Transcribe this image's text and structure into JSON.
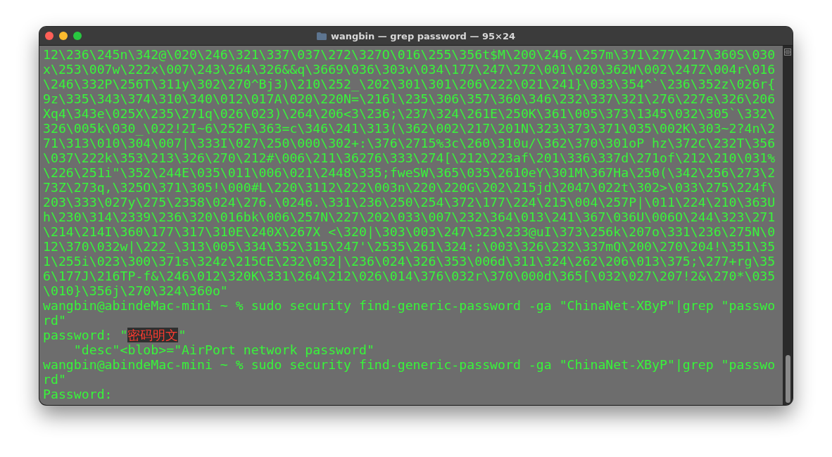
{
  "window": {
    "title": "wangbin — grep password — 95×24"
  },
  "lines": [
    {
      "text": "12\\236\\245n\\342@\\020\\246\\321\\337\\037\\272\\327O\\016\\255\\356t$M\\200\\246,\\257m\\371\\277\\217\\360S\\030"
    },
    {
      "text": "x\\253\\007w\\222x\\007\\243\\264\\326&&q\\3669\\036\\303v\\034\\177\\247\\272\\001\\020\\362W\\002\\247Z\\004r\\016"
    },
    {
      "text": "\\246\\332P\\256T\\311y\\302\\270^Bj3)\\210\\252_\\202\\301\\301\\206\\222\\021\\241}\\033\\354^`\\236\\352z\\026r{"
    },
    {
      "text": "9z\\335\\343\\374\\310\\340\\012\\017A\\020\\220N=\\216l\\235\\306\\357\\360\\346\\232\\337\\321\\276\\227e\\326\\206"
    },
    {
      "text": "Xq4\\343e\\025X\\235\\271q\\026\\023)\\264\\206<3\\236;\\237\\324\\261E\\250K\\361\\005\\373\\1345\\032\\305`\\332\\"
    },
    {
      "text": "326\\005k\\030_\\022!2I~6\\252F\\363=c\\346\\241\\313(\\362\\002\\217\\201N\\323\\373\\371\\035\\002K\\303~2?4n\\2"
    },
    {
      "text": "71\\313\\010\\304\\007|\\333I\\027\\250\\000\\302+:\\376\\2715%3c\\260\\310u/\\362\\370\\301oP hz\\372C\\232T\\356"
    },
    {
      "text": "\\037\\222k\\353\\213\\326\\270\\212#\\006\\211\\36276\\333\\274[\\212\\223af\\201\\336\\337d\\271of\\212\\210\\031%"
    },
    {
      "text": "\\226\\251i\"\\352\\244E\\035\\011\\006\\021\\2448\\335;fweSW\\365\\035\\2610eY\\301M\\367Ha\\250(\\342\\256\\273\\2"
    },
    {
      "text": "73Z\\273q,\\325O\\371\\305!\\000#L\\220\\3112\\222\\003n\\220\\220G\\202\\215jd\\2047\\022t\\302>\\033\\275\\224f\\"
    },
    {
      "text": "203\\333\\027y\\275\\2358\\024\\276.\\0246.\\331\\236\\250\\254\\372\\177\\224\\215\\004\\257P|\\011\\224\\210\\363U"
    },
    {
      "text": "h\\230\\314\\2339\\236\\320\\016bk\\006\\257N\\227\\202\\033\\007\\232\\364\\013\\241\\367\\036U\\006O\\244\\323\\271"
    },
    {
      "text": "\\214\\214I\\360\\177\\317\\310E\\240X\\267X <\\320|\\303\\003\\247\\323\\233@uI\\373\\256k\\207o\\331\\236\\275N\\0"
    },
    {
      "text": "12\\370\\032w|\\222_\\313\\005\\334\\352\\315\\247'\\2535\\261\\324:;\\003\\326\\232\\337mQ\\200\\270\\204!\\351\\35"
    },
    {
      "text": "1\\255i\\023\\300\\371s\\324z\\215CE\\232\\032|\\236\\024\\326\\353\\006d\\311\\324\\262\\206\\013\\375;\\277+rg\\35"
    },
    {
      "text": "6\\177J\\216TP-f&\\246\\012\\320K\\331\\264\\212\\026\\014\\376\\032r\\370\\000d\\365[\\032\\027\\207!2&\\270*\\035"
    },
    {
      "text": "\\010}\\356j\\270\\324\\360o\""
    },
    {
      "text": "wangbin@abindeMac-mini ~ % sudo security find-generic-password -ga \"ChinaNet-XByP\"|grep \"passwo"
    },
    {
      "text": "rd\""
    },
    {
      "parts": [
        {
          "text": "password: \"",
          "highlighted": false
        },
        {
          "text": "密码明文",
          "highlighted": true
        },
        {
          "text": "\"",
          "highlighted": false
        }
      ]
    },
    {
      "text": "    \"desc\"<blob>=\"AirPort network password\""
    },
    {
      "text": "wangbin@abindeMac-mini ~ % sudo security find-generic-password -ga \"ChinaNet-XByP\"|grep \"passwo"
    },
    {
      "text": "rd\""
    },
    {
      "text": "Password:"
    }
  ]
}
